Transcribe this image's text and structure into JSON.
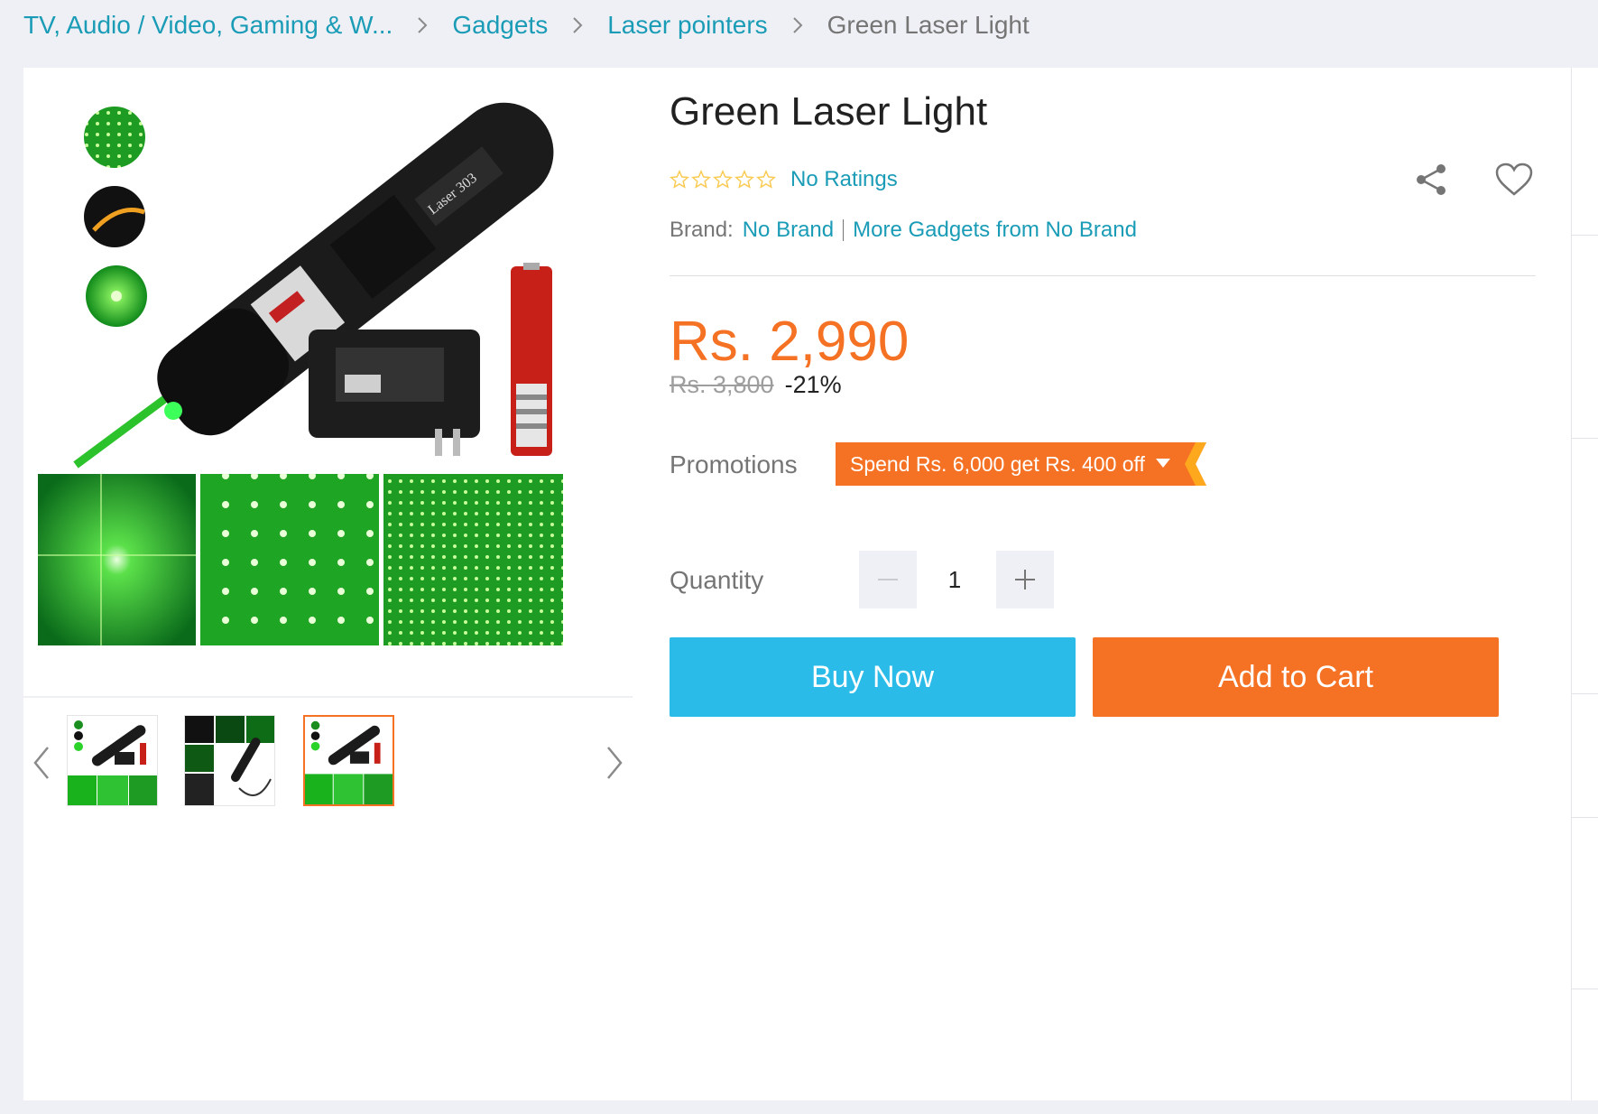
{
  "breadcrumb": {
    "items": [
      "TV, Audio / Video, Gaming & W...",
      "Gadgets",
      "Laser pointers"
    ],
    "current": "Green Laser Light"
  },
  "gallery": {
    "main_image": "green-laser-pointer-product-photo",
    "thumbnails": [
      {
        "label": "laser pointer with charger and battery"
      },
      {
        "label": "laser pointer collage"
      },
      {
        "label": "laser pointer with charger and battery",
        "selected": true
      }
    ]
  },
  "product": {
    "title": "Green Laser Light",
    "rating_text": "No Ratings",
    "stars_filled": 0,
    "stars_total": 5,
    "brand_label": "Brand:",
    "brand": "No Brand",
    "more_from_brand": "More Gadgets from No Brand",
    "price": "Rs. 2,990",
    "original_price": "Rs. 3,800",
    "discount": "-21%",
    "promotions_label": "Promotions",
    "promotion": "Spend Rs. 6,000 get Rs. 400 off",
    "quantity_label": "Quantity",
    "quantity": "1",
    "buy_now": "Buy Now",
    "add_to_cart": "Add to Cart"
  },
  "colors": {
    "accent_orange": "#f57224",
    "link_blue": "#1a9cb7",
    "buy_blue": "#2abbe8",
    "page_bg": "#eff0f5",
    "star_outline": "#faca51"
  },
  "icons": [
    "chevron-right-icon",
    "share-icon",
    "heart-icon",
    "star-icon",
    "minus-icon",
    "plus-icon",
    "chevron-left-icon"
  ]
}
